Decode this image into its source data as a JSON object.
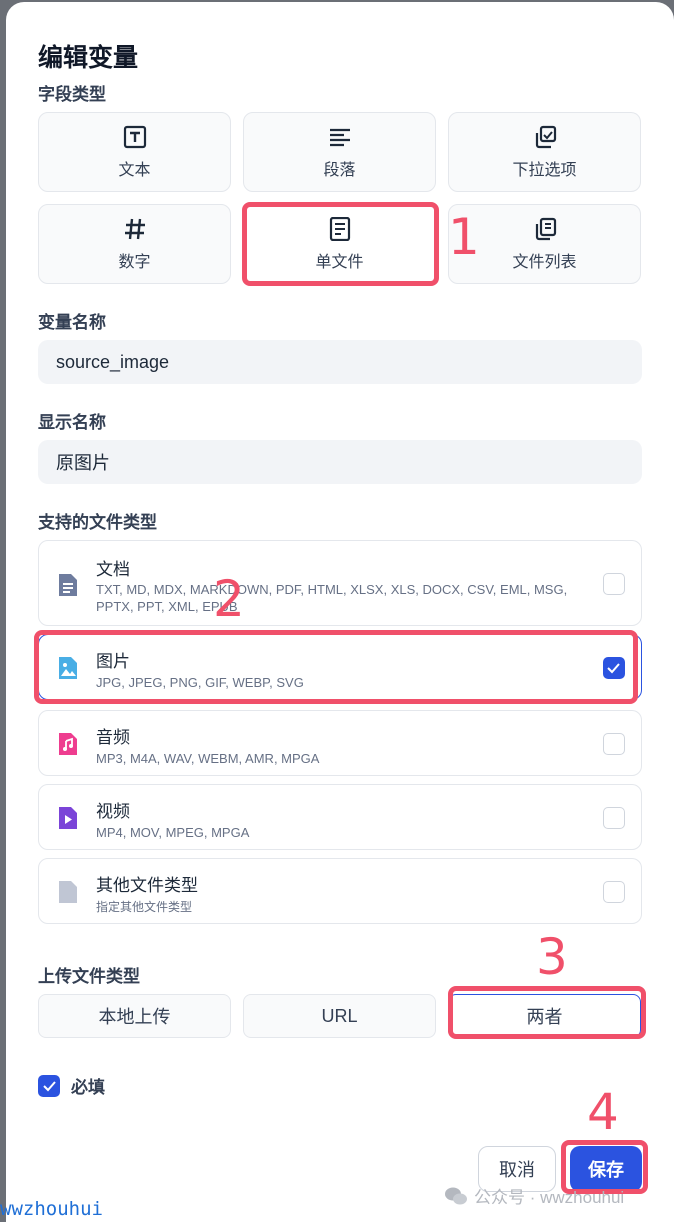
{
  "dialog": {
    "title": "编辑变量"
  },
  "field_type": {
    "label": "字段类型",
    "options": [
      {
        "label": "文本",
        "icon": "text-icon"
      },
      {
        "label": "段落",
        "icon": "paragraph-icon"
      },
      {
        "label": "下拉选项",
        "icon": "select-icon"
      },
      {
        "label": "数字",
        "icon": "hash-icon"
      },
      {
        "label": "单文件",
        "icon": "file-icon",
        "selected": true
      },
      {
        "label": "文件列表",
        "icon": "file-list-icon"
      }
    ]
  },
  "variable_name": {
    "label": "变量名称",
    "value": "source_image"
  },
  "display_name": {
    "label": "显示名称",
    "value": "原图片"
  },
  "file_types": {
    "label": "支持的文件类型",
    "items": [
      {
        "name": "文档",
        "extensions": "TXT, MD, MDX, MARKDOWN, PDF, HTML, XLSX, XLS, DOCX, CSV, EML, MSG, PPTX, PPT, XML, EPUB",
        "checked": false,
        "icon": "document-icon",
        "color": "#6e7c9e"
      },
      {
        "name": "图片",
        "extensions": "JPG, JPEG, PNG, GIF, WEBP, SVG",
        "checked": true,
        "icon": "image-icon",
        "color": "#49aee5"
      },
      {
        "name": "音频",
        "extensions": "MP3, M4A, WAV, WEBM, AMR, MPGA",
        "checked": false,
        "icon": "audio-icon",
        "color": "#ee3d8f"
      },
      {
        "name": "视频",
        "extensions": "MP4, MOV, MPEG, MPGA",
        "checked": false,
        "icon": "video-icon",
        "color": "#7b44d8"
      },
      {
        "name": "其他文件类型",
        "extensions": "指定其他文件类型",
        "checked": false,
        "icon": "other-file-icon",
        "color": "#c0c6d4"
      }
    ]
  },
  "upload_type": {
    "label": "上传文件类型",
    "options": [
      {
        "label": "本地上传",
        "selected": false
      },
      {
        "label": "URL",
        "selected": false
      },
      {
        "label": "两者",
        "selected": true
      }
    ]
  },
  "required": {
    "label": "必填",
    "checked": true
  },
  "buttons": {
    "cancel": "取消",
    "save": "保存"
  },
  "annotations": [
    "1",
    "2",
    "3",
    "4"
  ],
  "watermark": {
    "left": "wwzhouhui",
    "right": "公众号 · wwzhouhui"
  },
  "colors": {
    "accent": "#2b53e0",
    "annotation": "#f0506a"
  }
}
